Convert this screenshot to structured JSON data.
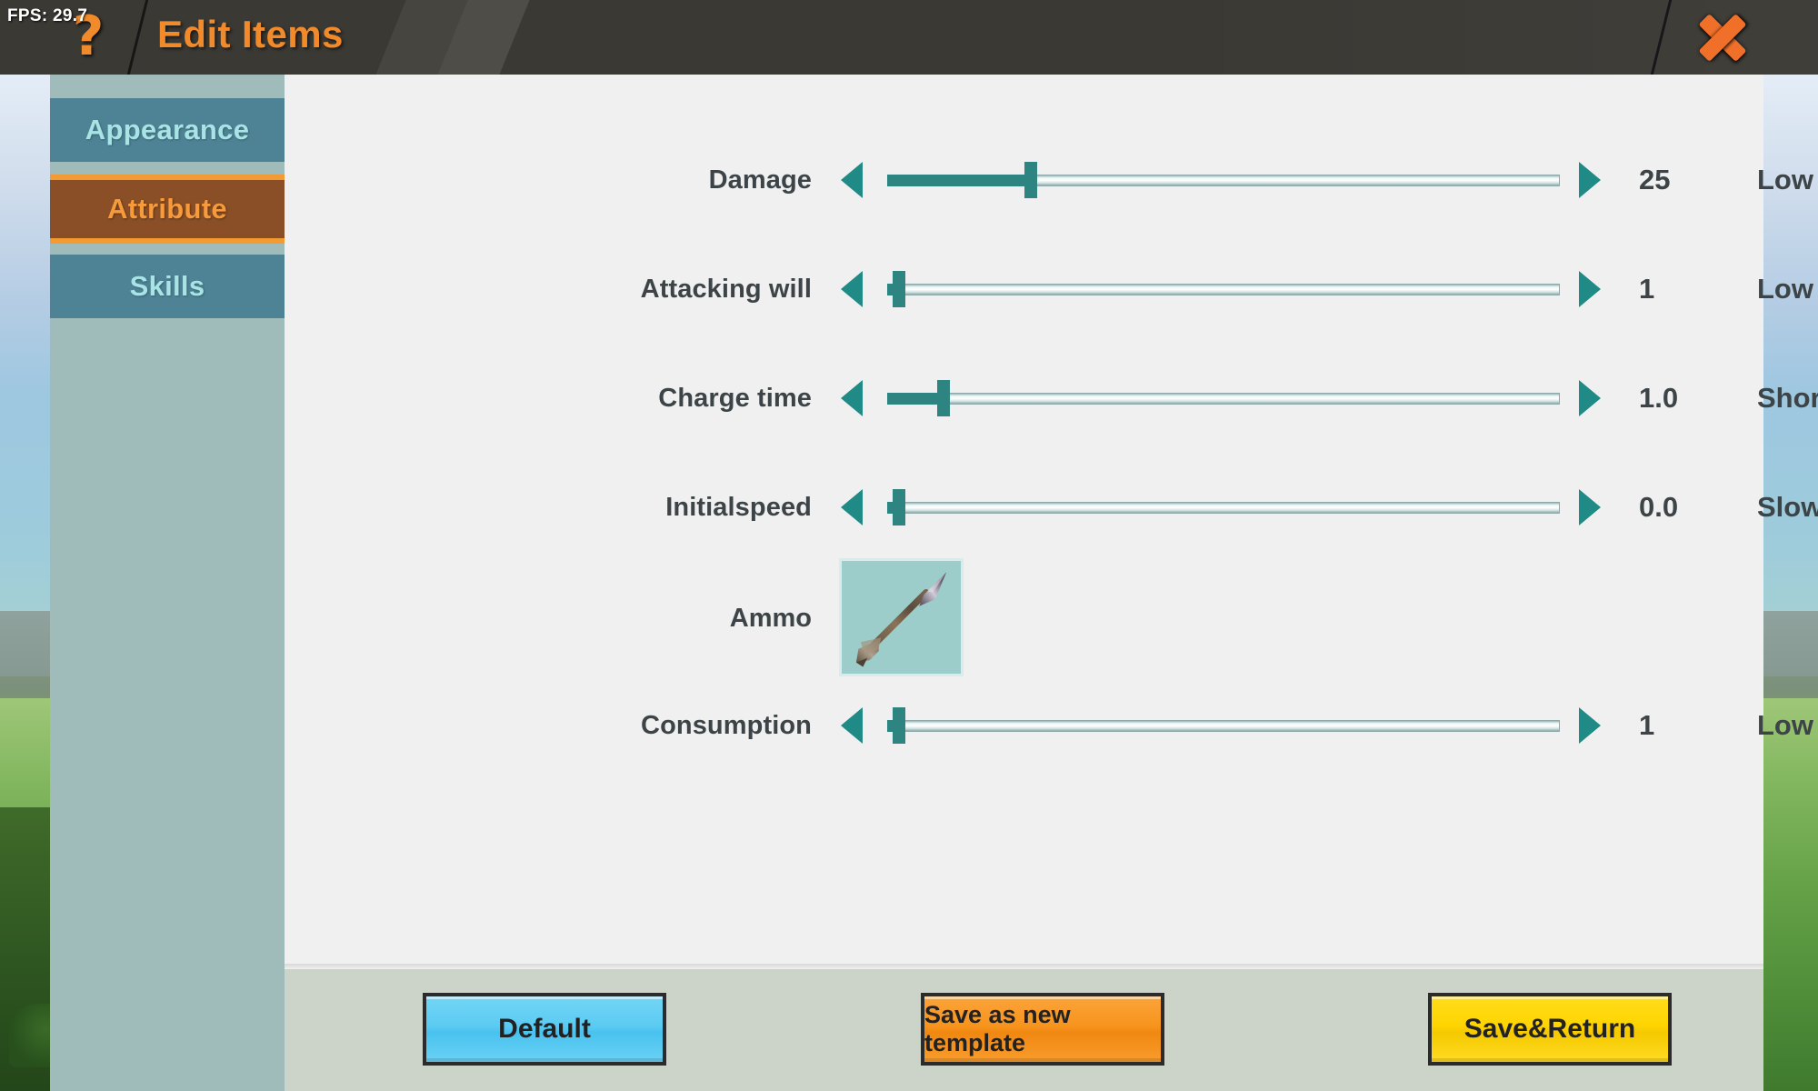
{
  "header": {
    "fps": "FPS: 29.7",
    "help_icon": "?",
    "title": "Edit Items",
    "close_icon": "close-x-icon",
    "accent_color": "#f08a2a",
    "bar_color": "#3b3934"
  },
  "sidebar": {
    "tabs": [
      {
        "label": "Appearance",
        "active": false
      },
      {
        "label": "Attribute",
        "active": true
      },
      {
        "label": "Skills",
        "active": false
      }
    ],
    "background_color": "#9fbbba",
    "active_tab_color": "#8a4f26",
    "inactive_tab_color": "#4e8395"
  },
  "main": {
    "background_color": "#f0f0f0",
    "accent_color": "#1f8a86",
    "rows": [
      {
        "label": "Damage",
        "value": "25",
        "descriptor": "Low",
        "fill_percent": 20.5
      },
      {
        "label": "Attacking will",
        "value": "1",
        "descriptor": "Low",
        "fill_percent": 1.0
      },
      {
        "label": "Charge time",
        "value": "1.0",
        "descriptor": "Short",
        "fill_percent": 7.5
      },
      {
        "label": "Initialspeed",
        "value": "0.0",
        "descriptor": "Slow",
        "fill_percent": 1.0
      },
      {
        "label": "Consumption",
        "value": "1",
        "descriptor": "Low",
        "fill_percent": 1.0
      }
    ],
    "ammo": {
      "label": "Ammo",
      "icon": "arrow-ammo-icon",
      "slot_color": "#9ccdcb"
    }
  },
  "footer": {
    "background_color": "#ccd3c9",
    "buttons": [
      {
        "label": "Default",
        "color": "#5ccbf2"
      },
      {
        "label": "Save as new template",
        "color": "#f7941e"
      },
      {
        "label": "Save&Return",
        "color": "#ffd400"
      }
    ]
  }
}
